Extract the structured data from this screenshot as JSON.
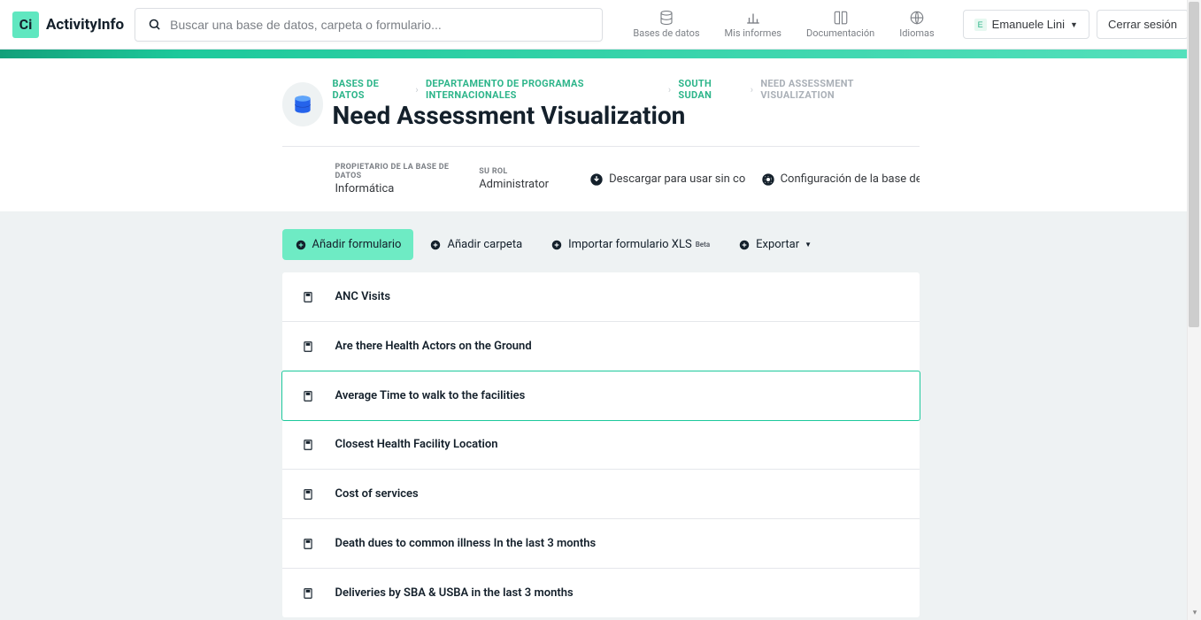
{
  "header": {
    "logo_text": "ActivityInfo",
    "search_placeholder": "Buscar una base de datos, carpeta o formulario...",
    "nav": {
      "databases": "Bases de datos",
      "reports": "Mis informes",
      "documentation": "Documentación",
      "languages": "Idiomas"
    },
    "user_initial": "E",
    "user_name": "Emanuele Lini",
    "logout": "Cerrar sesión"
  },
  "breadcrumbs": {
    "items": [
      "BASES DE DATOS",
      "DEPARTAMENTO DE PROGRAMAS INTERNACIONALES",
      "SOUTH SUDAN"
    ],
    "current": "NEED ASSESSMENT VISUALIZATION"
  },
  "page_title": "Need Assessment Visualization",
  "meta": {
    "owner_label": "PROPIETARIO DE LA BASE DE DATOS",
    "owner_value": "Informática",
    "role_label": "SU ROL",
    "role_value": "Administrator",
    "download_label": "Descargar para usar sin conexi...",
    "config_label": "Configuración de la base de dat..."
  },
  "actions": {
    "add_form": "Añadir formulario",
    "add_folder": "Añadir carpeta",
    "import_xls": "Importar formulario XLS",
    "beta_tag": "Beta",
    "export": "Exportar"
  },
  "forms": [
    {
      "name": "ANC Visits",
      "selected": false
    },
    {
      "name": "Are there Health Actors on the Ground",
      "selected": false
    },
    {
      "name": "Average Time to walk to the facilities",
      "selected": true
    },
    {
      "name": "Closest Health Facility Location",
      "selected": false
    },
    {
      "name": "Cost of services",
      "selected": false
    },
    {
      "name": "Death dues to common illness In the last 3 months",
      "selected": false
    },
    {
      "name": "Deliveries by SBA & USBA in the last 3 months",
      "selected": false
    }
  ]
}
